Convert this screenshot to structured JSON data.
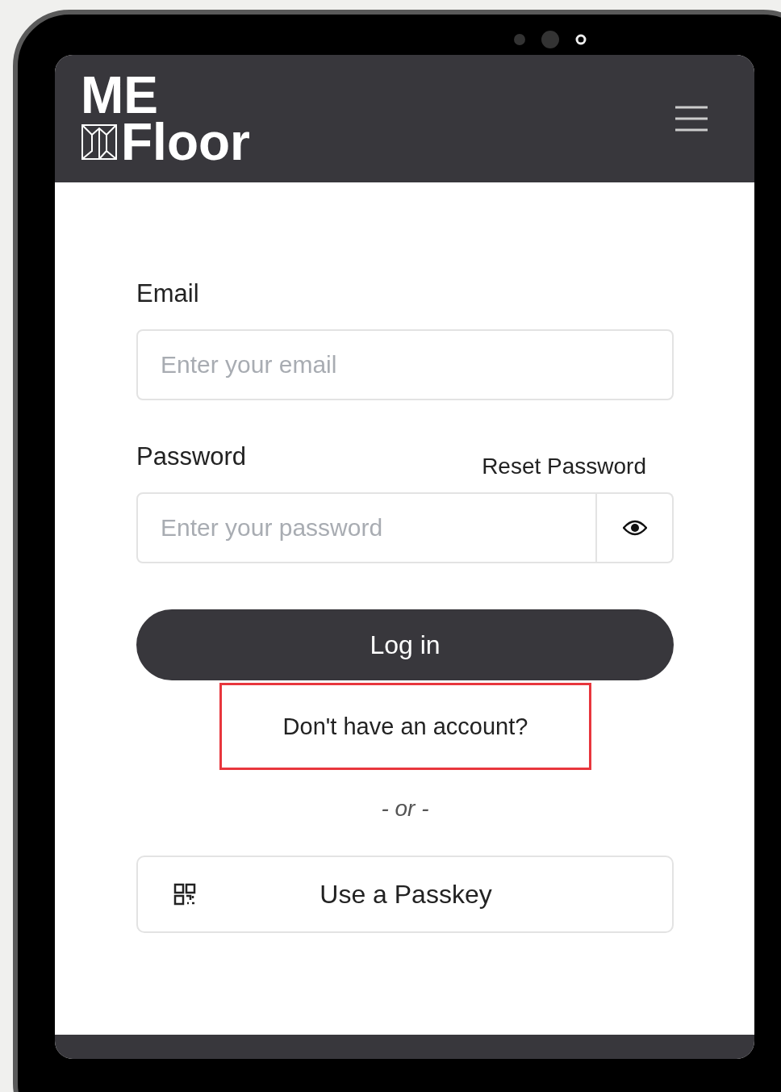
{
  "header": {
    "logo": [
      "ME",
      "Floor"
    ]
  },
  "email": {
    "label": "Email",
    "placeholder": "Enter your email"
  },
  "password": {
    "label": "Password",
    "reset_link": "Reset Password",
    "placeholder": "Enter your password"
  },
  "login_button": "Log in",
  "account_prompt": "Don't have an account?",
  "separator": "- or -",
  "passkey_button": "Use a Passkey"
}
